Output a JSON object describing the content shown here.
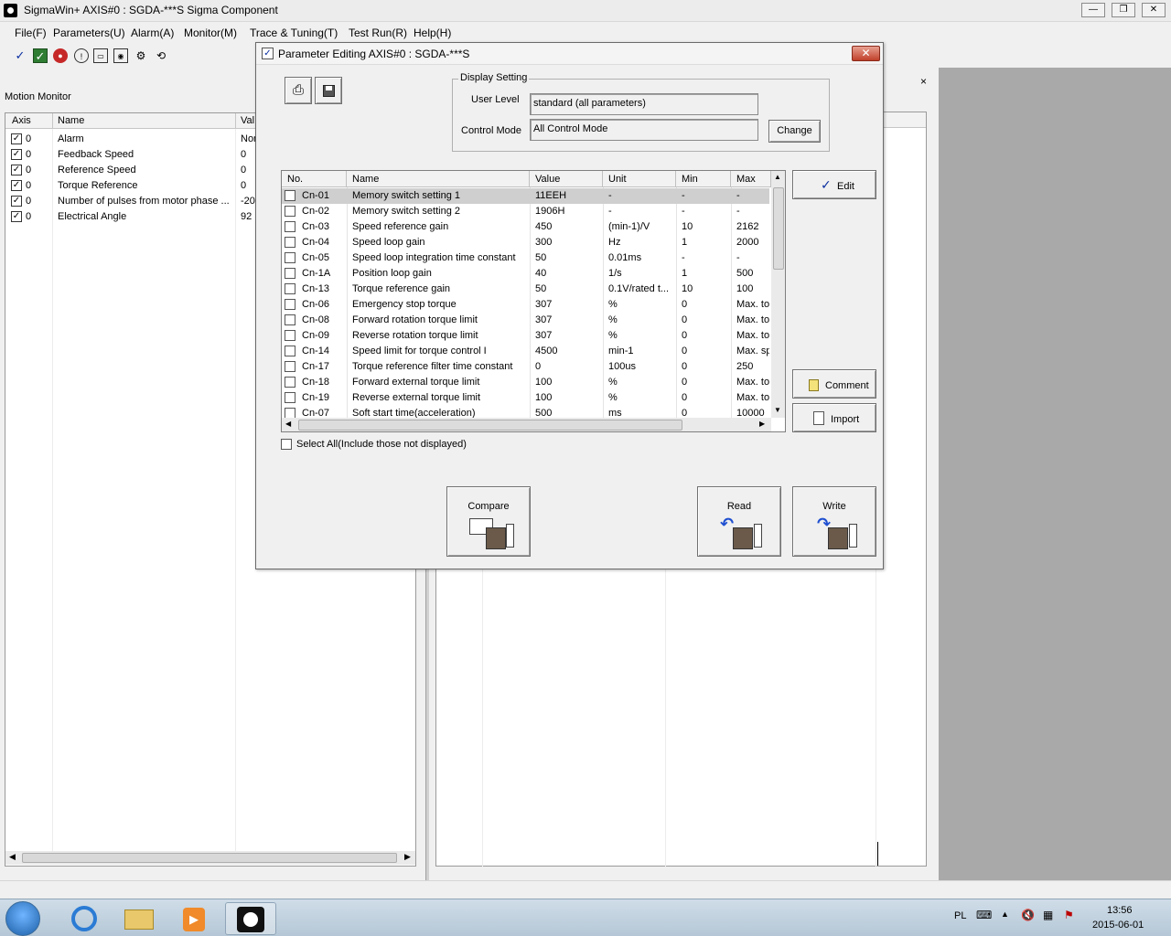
{
  "window": {
    "title": "SigmaWin+ AXIS#0 : SGDA-***S Sigma Component"
  },
  "menu": [
    "File(F)",
    "Parameters(U)",
    "Alarm(A)",
    "Monitor(M)",
    "Trace & Tuning(T)",
    "Test Run(R)",
    "Help(H)"
  ],
  "toolbar_icons": [
    "check-icon",
    "verify-icon",
    "stop-icon",
    "info-icon",
    "monitor-icon",
    "trace-icon",
    "tuning-icon",
    "jog-icon"
  ],
  "motion_monitor": {
    "label": "Motion Monitor",
    "columns": [
      "Axis",
      "Name",
      "Val"
    ],
    "rows": [
      {
        "axis": "0",
        "name": "Alarm",
        "value": "Nor"
      },
      {
        "axis": "0",
        "name": "Feedback Speed",
        "value": "0"
      },
      {
        "axis": "0",
        "name": "Reference Speed",
        "value": "0"
      },
      {
        "axis": "0",
        "name": "Torque Reference",
        "value": "0"
      },
      {
        "axis": "0",
        "name": "Number of pulses from motor phase ...",
        "value": "-20"
      },
      {
        "axis": "0",
        "name": "Electrical Angle",
        "value": "92"
      }
    ]
  },
  "right_panel": {
    "close_label": "×"
  },
  "dialog": {
    "title": "Parameter Editing AXIS#0 : SGDA-***S",
    "close_label": "✕",
    "display_setting": {
      "legend": "Display Setting",
      "user_level_label": "User Level",
      "user_level_value": "standard (all parameters)",
      "control_mode_label": "Control Mode",
      "control_mode_value": "All Control Mode",
      "change_label": "Change"
    },
    "columns": [
      "No.",
      "Name",
      "Value",
      "Unit",
      "Min",
      "Max"
    ],
    "params": [
      {
        "no": "Cn-01",
        "name": "Memory switch setting 1",
        "value": "11EEH",
        "unit": "-",
        "min": "-",
        "max": "-"
      },
      {
        "no": "Cn-02",
        "name": "Memory switch setting 2",
        "value": "1906H",
        "unit": "-",
        "min": "-",
        "max": "-"
      },
      {
        "no": "Cn-03",
        "name": "Speed reference gain",
        "value": "450",
        "unit": "(min-1)/V",
        "min": "10",
        "max": "2162"
      },
      {
        "no": "Cn-04",
        "name": "Speed loop gain",
        "value": "300",
        "unit": "Hz",
        "min": "1",
        "max": "2000"
      },
      {
        "no": "Cn-05",
        "name": "Speed loop integration time constant",
        "value": "50",
        "unit": "0.01ms",
        "min": "-",
        "max": "-"
      },
      {
        "no": "Cn-1A",
        "name": "Position loop gain",
        "value": "40",
        "unit": "1/s",
        "min": "1",
        "max": "500"
      },
      {
        "no": "Cn-13",
        "name": "Torque reference gain",
        "value": "50",
        "unit": "0.1V/rated t...",
        "min": "10",
        "max": "100"
      },
      {
        "no": "Cn-06",
        "name": "Emergency stop torque",
        "value": "307",
        "unit": "%",
        "min": "0",
        "max": "Max. tor"
      },
      {
        "no": "Cn-08",
        "name": "Forward rotation torque limit",
        "value": "307",
        "unit": "%",
        "min": "0",
        "max": "Max. tor"
      },
      {
        "no": "Cn-09",
        "name": "Reverse rotation torque limit",
        "value": "307",
        "unit": "%",
        "min": "0",
        "max": "Max. tor"
      },
      {
        "no": "Cn-14",
        "name": "Speed limit for torque control I",
        "value": "4500",
        "unit": "min-1",
        "min": "0",
        "max": "Max. sp"
      },
      {
        "no": "Cn-17",
        "name": "Torque reference filter time constant",
        "value": "0",
        "unit": "100us",
        "min": "0",
        "max": "250"
      },
      {
        "no": "Cn-18",
        "name": "Forward external torque limit",
        "value": "100",
        "unit": "%",
        "min": "0",
        "max": "Max. tor"
      },
      {
        "no": "Cn-19",
        "name": "Reverse external torque limit",
        "value": "100",
        "unit": "%",
        "min": "0",
        "max": "Max. tor"
      },
      {
        "no": "Cn-07",
        "name": "Soft start time(acceleration)",
        "value": "500",
        "unit": "ms",
        "min": "0",
        "max": "10000"
      }
    ],
    "edit_label": "Edit",
    "comment_label": "Comment",
    "import_label": "Import",
    "select_all_label": "Select All(Include those not displayed)",
    "compare_label": "Compare",
    "read_label": "Read",
    "write_label": "Write"
  },
  "taskbar": {
    "lang": "PL",
    "time": "13:56",
    "date": "2015-06-01"
  }
}
